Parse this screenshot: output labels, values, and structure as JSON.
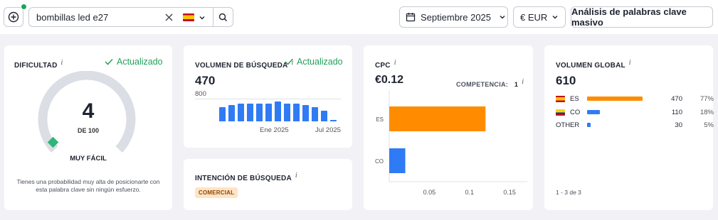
{
  "search": {
    "keyword": "bombillas led e27",
    "country_flag": "flag-es",
    "add_icon": "plus-circle-icon",
    "clear_icon": "close-icon",
    "search_icon": "search-icon"
  },
  "toolbar": {
    "date_label": "Septiembre 2025",
    "currency_label": "€ EUR",
    "bulk_label": "Análisis de palabras clave masivo"
  },
  "difficulty": {
    "title": "DIFICULTAD",
    "info": "i",
    "updated_label": "Actualizado",
    "value": "4",
    "of_label": "DE 100",
    "score": 4,
    "max": 100,
    "level_label": "MUY FÁCIL",
    "description": "Tienes una probabilidad muy alta de posicionarte con esta palabra clave sin ningún esfuerzo."
  },
  "volume": {
    "title": "VOLUMEN DE BÚSQUEDA",
    "info": "i",
    "updated_label": "Actualizado",
    "value": "470",
    "scale_max_label": "800",
    "scale_max": 800,
    "x_label_mid": "Ene 2025",
    "x_label_end": "Jul 2025",
    "monthly_values": [
      390,
      440,
      470,
      470,
      470,
      470,
      540,
      470,
      470,
      440,
      390,
      290,
      50
    ]
  },
  "intent": {
    "title": "INTENCIÓN DE BÚSQUEDA",
    "info": "i",
    "badge": "COMERCIAL"
  },
  "cpc": {
    "title": "CPC",
    "info": "i",
    "value": "€0.12",
    "competition_label": "COMPETENCIA:",
    "competition_value": "1",
    "competition_info": "i"
  },
  "global": {
    "title": "VOLUMEN GLOBAL",
    "info": "i",
    "value": "610",
    "rows": [
      {
        "code": "ES",
        "flag": "flag-es",
        "volume": "470",
        "pct": "77%",
        "share": 0.77,
        "color": "#ff8c00"
      },
      {
        "code": "CO",
        "flag": "flag-co",
        "volume": "110",
        "pct": "18%",
        "share": 0.18,
        "color": "#2f7bf5"
      },
      {
        "code": "OTHER",
        "flag": "",
        "volume": "30",
        "pct": "5%",
        "share": 0.05,
        "color": "#2f7bf5"
      }
    ],
    "footer": "1 - 3 de 3"
  },
  "chart_data": {
    "type": "bar",
    "orientation": "horizontal",
    "categories": [
      "ES",
      "CO"
    ],
    "values": [
      0.12,
      0.02
    ],
    "colors": [
      "#ff8c00",
      "#2f7bf5"
    ],
    "x_ticks": [
      "0.05",
      "0.1",
      "0.15"
    ],
    "xlim": [
      0,
      0.16
    ],
    "grid": false
  }
}
